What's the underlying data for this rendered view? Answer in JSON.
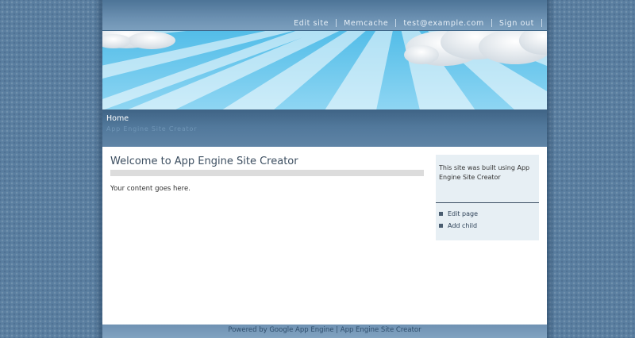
{
  "topnav": {
    "edit_site": "Edit site",
    "memcache": "Memcache",
    "user_email": "test@example.com",
    "sign_out": "Sign out"
  },
  "header": {
    "breadcrumb": "Home",
    "site_title": "App Engine Site Creator"
  },
  "main": {
    "heading": "Welcome to App Engine Site Creator",
    "body": "Your content goes here."
  },
  "sidebar": {
    "text": "This site was built using App Engine Site Creator",
    "links": [
      "Edit page",
      "Add child"
    ]
  },
  "footer": {
    "powered_by": "Powered by Google App Engine",
    "separator": "|",
    "site_creator": "App Engine Site Creator"
  },
  "colors": {
    "page_background": "#5a7ea0",
    "header_bar": "#51789b",
    "sky": "#5ec3ea",
    "sidebar_background": "#e7eff4"
  }
}
